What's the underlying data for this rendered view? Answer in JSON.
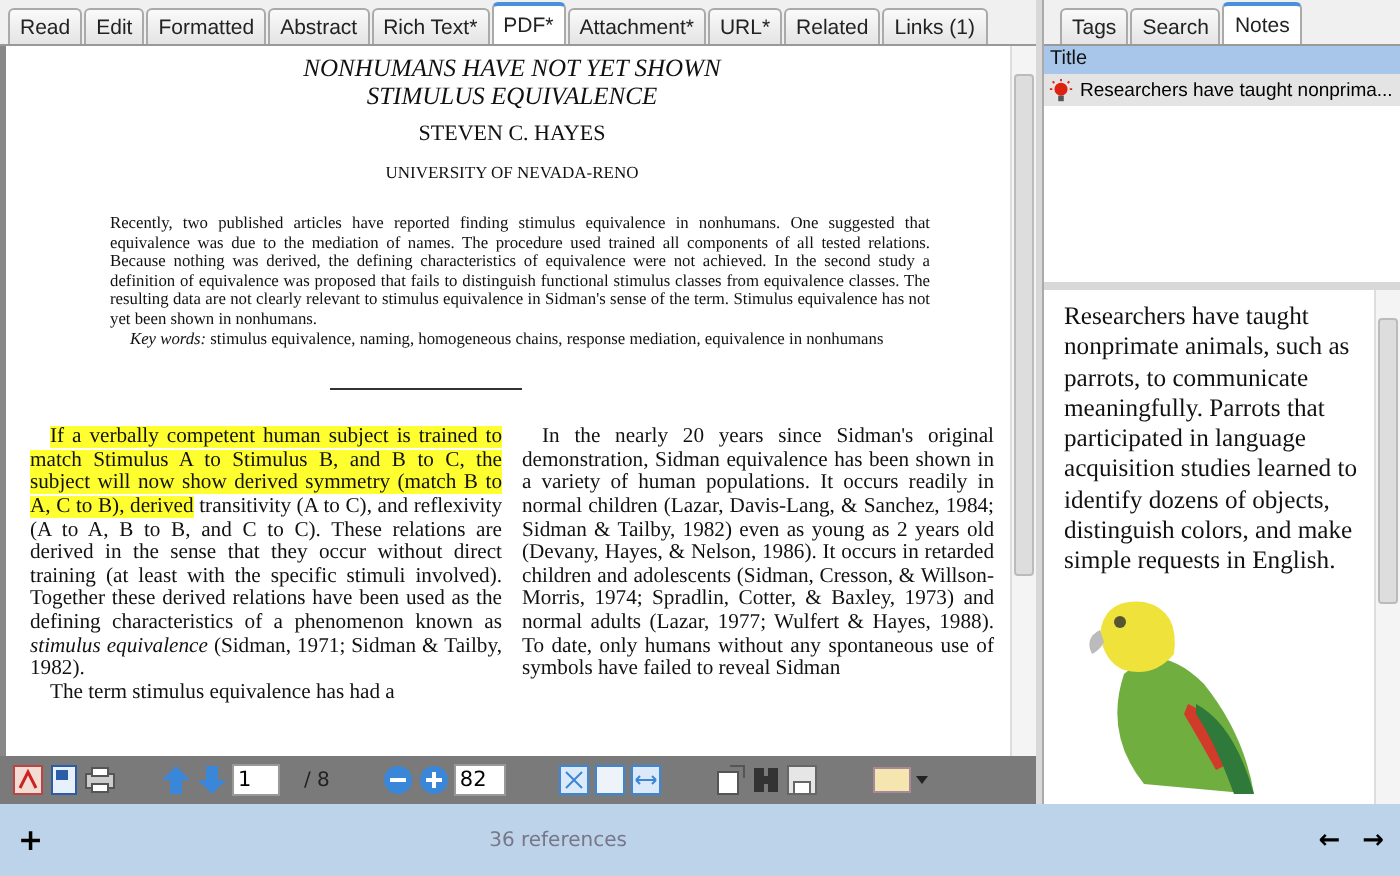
{
  "tabs": [
    {
      "label": "Read",
      "selected": false
    },
    {
      "label": "Edit",
      "selected": false
    },
    {
      "label": "Formatted",
      "selected": false
    },
    {
      "label": "Abstract",
      "selected": false
    },
    {
      "label": "Rich Text*",
      "selected": false
    },
    {
      "label": "PDF*",
      "selected": true
    },
    {
      "label": "Attachment*",
      "selected": false
    },
    {
      "label": "URL*",
      "selected": false
    },
    {
      "label": "Related",
      "selected": false
    },
    {
      "label": "Links (1)",
      "selected": false
    }
  ],
  "document": {
    "title_lines": [
      "NONHUMANS HAVE NOT YET SHOWN",
      "STIMULUS EQUIVALENCE"
    ],
    "author": "STEVEN C. HAYES",
    "affiliation": "UNIVERSITY OF NEVADA-RENO",
    "abstract": "Recently, two published articles have reported finding stimulus equivalence in nonhumans. One suggested that equivalence was due to the mediation of names. The procedure used trained all components of all tested relations. Because nothing was derived, the defining characteristics of equivalence were not achieved. In the second study a definition of equivalence was proposed that fails to distinguish functional stimulus classes from equivalence classes. The resulting data are not clearly relevant to stimulus equivalence in Sidman's sense of the term. Stimulus equivalence has not yet been shown in nonhumans.",
    "keywords": "*Key words:* stimulus equivalence, naming, homogeneous chains, response mediation, equivalence in nonhumans",
    "left_column": [
      [
        {
          "text": "If a verbally competent human subject is trained to match Stimulus A to Stimulus B, and B to C, the subject will now show derived symmetry (match B to A, C to B), derived",
          "highlighted": true
        },
        {
          "text": " transitivity (A to C), and reflexivity (A to A, B to B, and C to C). These relations are derived in the sense that they occur without direct training (at least with the specific stimuli involved). Together these derived relations have been used as the defining characteristics of a phenomenon known as *stimulus equivalence* (Sidman, 1971; Sidman & Tailby, 1982).",
          "highlighted": false
        }
      ],
      [
        {
          "text": "The term stimulus equivalence has had a",
          "highlighted": false
        }
      ]
    ],
    "right_column": [
      [
        {
          "text": "In the nearly 20 years since Sidman's original demonstration, Sidman equivalence has been shown in a variety of human populations. It occurs readily in normal children (Lazar, Davis-Lang, & Sanchez, 1984; Sidman & Tailby, 1982) even as young as 2 years old (Devany, Hayes, & Nelson, 1986). It occurs in retarded children and adolescents (Sidman, Cresson, & Willson-Morris, 1974; Spradlin, Cotter, & Baxley, 1973) and normal adults (Lazar, 1977; Wulfert & Hayes, 1988). To date, only humans without any spontaneous use of symbols have failed to reveal Sidman",
          "highlighted": false
        }
      ]
    ]
  },
  "pdf_toolbar": {
    "page": "1",
    "page_count": "/ 8",
    "zoom": "82"
  },
  "side_tabs": [
    {
      "label": "Tags",
      "selected": false
    },
    {
      "label": "Search",
      "selected": false
    },
    {
      "label": "Notes",
      "selected": true
    }
  ],
  "notes_list": {
    "column": "Title",
    "rows": [
      {
        "title": "Researchers have taught nonprima...",
        "selected": true
      }
    ]
  },
  "note_text": "Researchers have taught nonprimate animals, such as parrots, to communicate meaningfully. Parrots that participated in language acquisition studies learned to identify dozens of objects, distinguish colors, and make simple requests in English.",
  "status_bar": {
    "add": "+",
    "references": "36 references",
    "back": "←",
    "forward": "→"
  }
}
